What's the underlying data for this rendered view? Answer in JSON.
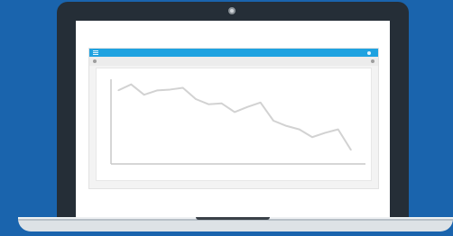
{
  "app": {
    "title": "",
    "user_name": ""
  },
  "icons": {
    "menu": "menu-icon",
    "user": "user-icon",
    "toolbar_left": "dot-icon",
    "toolbar_right": "dot-icon"
  },
  "colors": {
    "background": "#1a64ad",
    "laptop_bezel": "#252e37",
    "header_accent": "#1fa2e0",
    "chart_line": "#d2d2d2",
    "axis": "#c8c8c8"
  },
  "chart_data": {
    "type": "line",
    "title": "",
    "xlabel": "",
    "ylabel": "",
    "grid": false,
    "legend": "none",
    "x": [
      0,
      1,
      2,
      3,
      4,
      5,
      6,
      7,
      8,
      9,
      10,
      11,
      12,
      13,
      14,
      15,
      16,
      17,
      18
    ],
    "xlim": [
      0,
      18
    ],
    "ylim": [
      0,
      100
    ],
    "series": [
      {
        "name": "",
        "values": [
          85,
          92,
          80,
          85,
          86,
          88,
          75,
          69,
          70,
          60,
          66,
          71,
          50,
          44,
          40,
          31,
          36,
          40,
          16
        ]
      }
    ]
  }
}
